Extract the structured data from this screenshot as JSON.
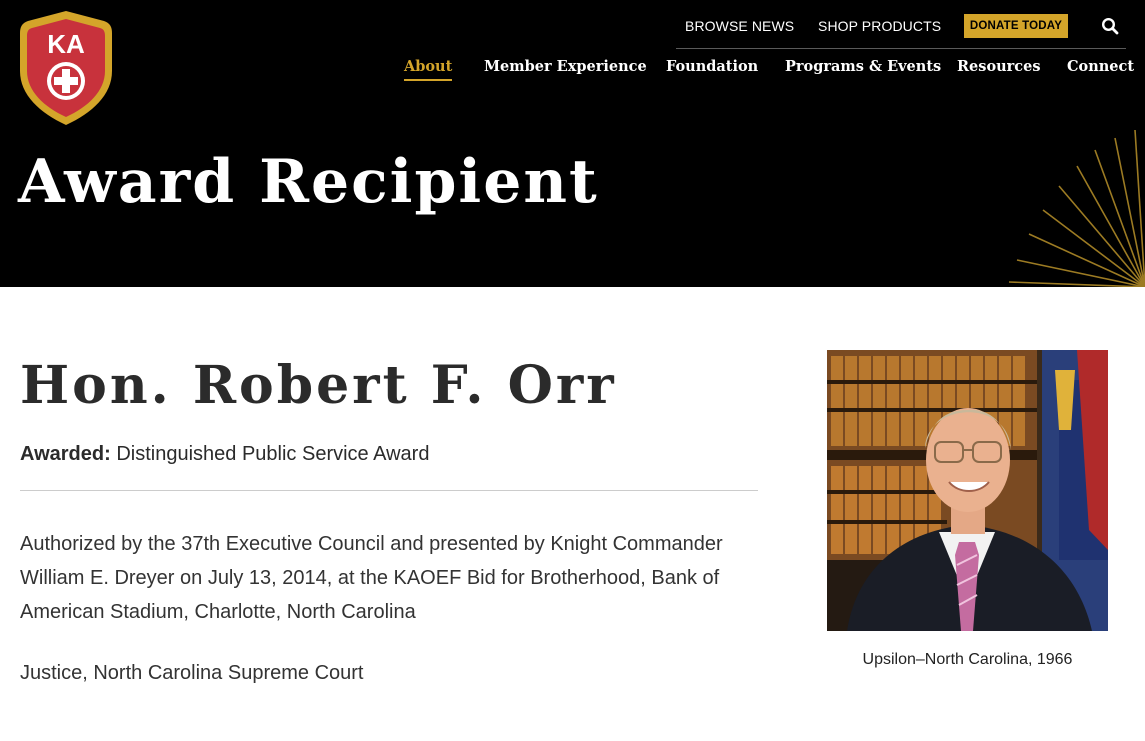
{
  "logo": {
    "text": "KA",
    "icon": "cross-shield-logo"
  },
  "utility_nav": {
    "browse_news": "BROWSE NEWS",
    "shop_products": "SHOP PRODUCTS",
    "donate": "DONATE TODAY",
    "search_icon": "search-icon"
  },
  "main_nav": {
    "items": [
      {
        "label": "About",
        "active": true
      },
      {
        "label": "Member Experience",
        "active": false
      },
      {
        "label": "Foundation",
        "active": false
      },
      {
        "label": "Programs & Events",
        "active": false
      },
      {
        "label": "Resources",
        "active": false
      },
      {
        "label": "Connect",
        "active": false
      }
    ]
  },
  "header": {
    "title": "Award Recipient"
  },
  "recipient": {
    "name": "Hon. Robert F. Orr",
    "awarded_label": "Awarded:",
    "award": "Distinguished Public Service Award",
    "bio": "Authorized by the 37th Executive Council and presented by Knight Commander William E. Dreyer on July 13, 2014, at the KAOEF Bid for Brotherhood, Bank of American Stadium, Charlotte, North Carolina",
    "position": "Justice, North Carolina Supreme Court",
    "caption": "Upsilon–North Carolina, 1966"
  },
  "colors": {
    "accent_gold": "#d4a52a",
    "header_bg": "#000000",
    "shield_red": "#c8323c",
    "text_dark": "#2b2b2b"
  }
}
